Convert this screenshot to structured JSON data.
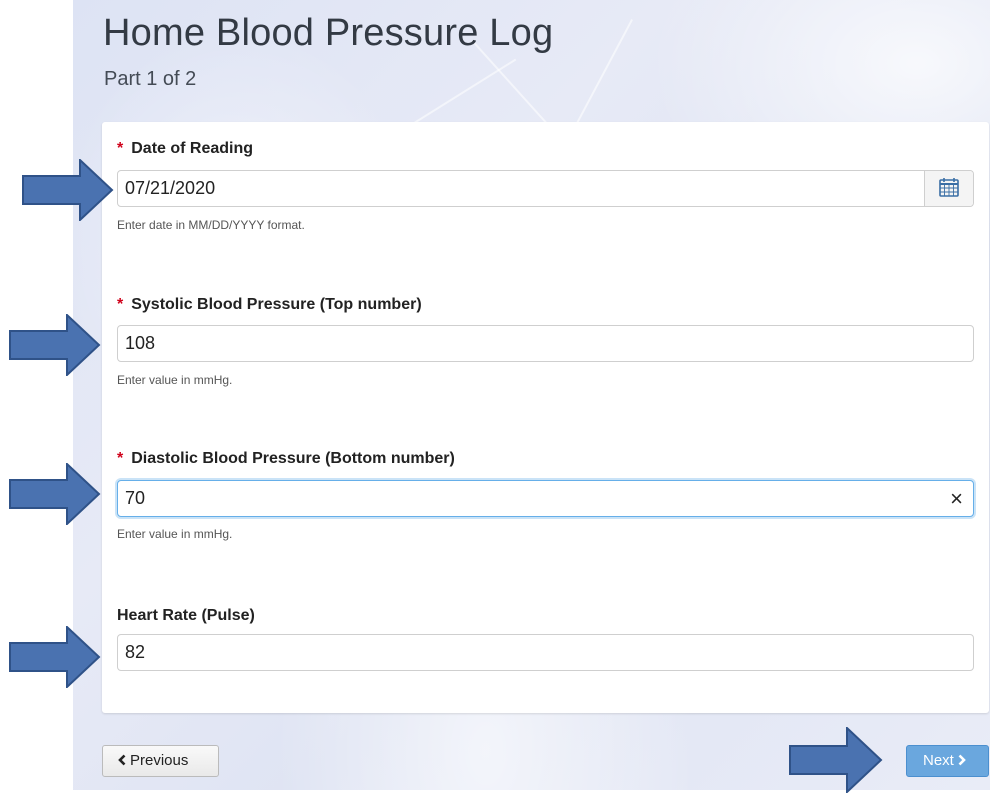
{
  "page": {
    "title": "Home Blood Pressure Log",
    "subtitle": "Part 1 of 2"
  },
  "fields": {
    "date": {
      "label": "Date of Reading",
      "required": true,
      "value": "07/21/2020",
      "hint": "Enter date in MM/DD/YYYY format.",
      "icon": "calendar-icon"
    },
    "systolic": {
      "label": "Systolic Blood Pressure (Top number)",
      "required": true,
      "value": "108",
      "hint": "Enter value in mmHg."
    },
    "diastolic": {
      "label": "Diastolic Blood Pressure (Bottom number)",
      "required": true,
      "value": "70",
      "hint": "Enter value in mmHg.",
      "clear_symbol": "×"
    },
    "heart_rate": {
      "label": "Heart Rate (Pulse)",
      "required": false,
      "value": "82"
    }
  },
  "required_marker": "*",
  "nav": {
    "previous_label": "Previous",
    "next_label": "Next",
    "previous_icon": "chevron-left-icon",
    "next_icon": "chevron-right-icon"
  },
  "colors": {
    "required": "#d0021b",
    "next_button": "#6aa7de",
    "annotation_arrow": "#4a72b0",
    "focus_border": "#66afe9"
  }
}
